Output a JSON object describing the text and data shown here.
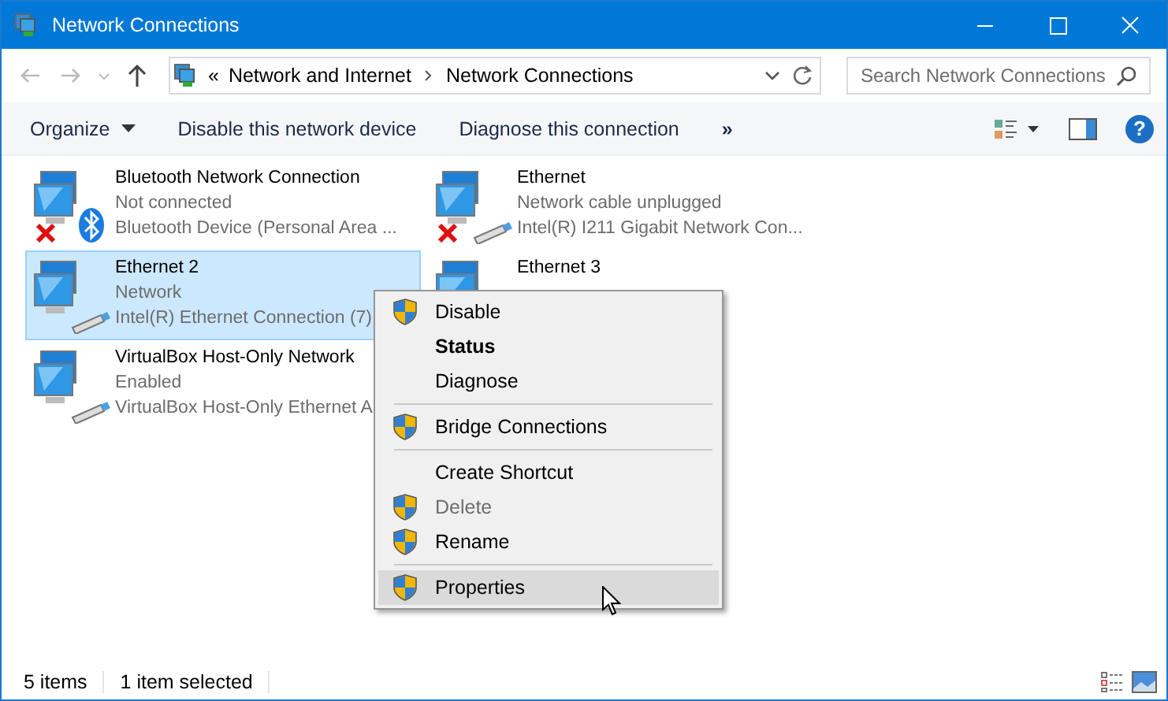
{
  "window": {
    "title": "Network Connections"
  },
  "address_bar": {
    "overflow": "«",
    "crumbs": [
      "Network and Internet",
      "Network Connections"
    ]
  },
  "search": {
    "placeholder": "Search Network Connections"
  },
  "toolbar": {
    "items": [
      {
        "label": "Organize",
        "dropdown": true
      },
      {
        "label": "Disable this network device",
        "dropdown": false
      },
      {
        "label": "Diagnose this connection",
        "dropdown": false
      }
    ],
    "more": "»",
    "help": "?"
  },
  "connections": [
    {
      "name": "Bluetooth Network Connection",
      "status": "Not connected",
      "device": "Bluetooth Device (Personal Area ...",
      "kind": "bluetooth",
      "disconnected": true,
      "selected": false
    },
    {
      "name": "Ethernet",
      "status": "Network cable unplugged",
      "device": "Intel(R) I211 Gigabit Network Con...",
      "kind": "ethernet",
      "disconnected": true,
      "selected": false
    },
    {
      "name": "Ethernet 2",
      "status": "Network",
      "device": "Intel(R) Ethernet Connection (7)",
      "kind": "ethernet",
      "disconnected": false,
      "selected": true
    },
    {
      "name": "Ethernet 3",
      "selected": false
    },
    {
      "name": "VirtualBox Host-Only Network",
      "status": "Enabled",
      "device": "VirtualBox Host-Only Ethernet A",
      "kind": "ethernet",
      "disconnected": false,
      "selected": false
    }
  ],
  "context_menu": [
    {
      "kind": "item",
      "label": "Disable",
      "shield": true,
      "default": false,
      "disabled": false,
      "selected": false
    },
    {
      "kind": "item",
      "label": "Status",
      "shield": false,
      "default": true,
      "disabled": false,
      "selected": false
    },
    {
      "kind": "item",
      "label": "Diagnose",
      "shield": false,
      "default": false,
      "disabled": false,
      "selected": false
    },
    {
      "kind": "separator"
    },
    {
      "kind": "item",
      "label": "Bridge Connections",
      "shield": true,
      "default": false,
      "disabled": false,
      "selected": false
    },
    {
      "kind": "separator"
    },
    {
      "kind": "item",
      "label": "Create Shortcut",
      "shield": false,
      "default": false,
      "disabled": false,
      "selected": false
    },
    {
      "kind": "item",
      "label": "Delete",
      "shield": true,
      "default": false,
      "disabled": true,
      "selected": false
    },
    {
      "kind": "item",
      "label": "Rename",
      "shield": true,
      "default": false,
      "disabled": false,
      "selected": false
    },
    {
      "kind": "separator"
    },
    {
      "kind": "item",
      "label": "Properties",
      "shield": true,
      "default": false,
      "disabled": false,
      "selected": true
    }
  ],
  "status_bar": {
    "count": "5 items",
    "selection": "1 item selected"
  }
}
